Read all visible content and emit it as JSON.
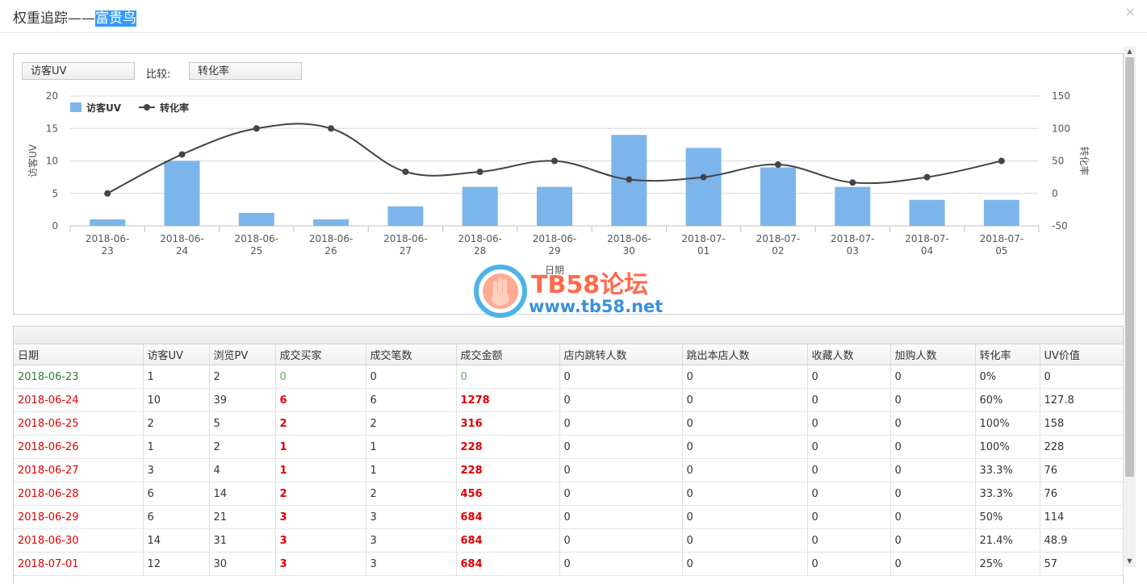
{
  "dialog": {
    "title_prefix": "权重追踪——",
    "title_highlight": "富贵鸟",
    "close": "×"
  },
  "controls": {
    "primary_select": "访客UV",
    "compare_label": "比较:",
    "compare_select": "转化率"
  },
  "chart_data": {
    "type": "bar+line",
    "categories": [
      "2018-06-23",
      "2018-06-24",
      "2018-06-25",
      "2018-06-26",
      "2018-06-27",
      "2018-06-28",
      "2018-06-29",
      "2018-06-30",
      "2018-07-01",
      "2018-07-02",
      "2018-07-03",
      "2018-07-04",
      "2018-07-05"
    ],
    "series": [
      {
        "name": "访客UV",
        "type": "bar",
        "axis": "left",
        "color": "#7cb5ec",
        "values": [
          1,
          10,
          2,
          1,
          3,
          6,
          6,
          14,
          12,
          9,
          6,
          4,
          4
        ]
      },
      {
        "name": "转化率",
        "type": "line",
        "axis": "right",
        "color": "#434348",
        "values": [
          0,
          60,
          100,
          100,
          33.3,
          33.3,
          50,
          21.4,
          25,
          44.4,
          16.7,
          25,
          50
        ]
      }
    ],
    "xlabel": "日期",
    "ylabel_left": "访客UV",
    "ylabel_right": "转化率",
    "ylim_left": [
      0,
      20
    ],
    "yticks_left": [
      0,
      5,
      10,
      15,
      20
    ],
    "ylim_right": [
      -50,
      150
    ],
    "yticks_right": [
      -50,
      0,
      50,
      100,
      150
    ],
    "grid": true,
    "legend": "top-left"
  },
  "table": {
    "columns": [
      "日期",
      "访客UV",
      "浏览PV",
      "成交买家",
      "成交笔数",
      "成交金额",
      "店内跳转人数",
      "跳出本店人数",
      "收藏人数",
      "加购人数",
      "转化率",
      "UV价值"
    ],
    "rows": [
      [
        "2018-06-23",
        "1",
        "2",
        "0",
        "0",
        "0",
        "0",
        "0",
        "0",
        "0",
        "0%",
        "0"
      ],
      [
        "2018-06-24",
        "10",
        "39",
        "6",
        "6",
        "1278",
        "0",
        "0",
        "0",
        "0",
        "60%",
        "127.8"
      ],
      [
        "2018-06-25",
        "2",
        "5",
        "2",
        "2",
        "316",
        "0",
        "0",
        "0",
        "0",
        "100%",
        "158"
      ],
      [
        "2018-06-26",
        "1",
        "2",
        "1",
        "1",
        "228",
        "0",
        "0",
        "0",
        "0",
        "100%",
        "228"
      ],
      [
        "2018-06-27",
        "3",
        "4",
        "1",
        "1",
        "228",
        "0",
        "0",
        "0",
        "0",
        "33.3%",
        "76"
      ],
      [
        "2018-06-28",
        "6",
        "14",
        "2",
        "2",
        "456",
        "0",
        "0",
        "0",
        "0",
        "33.3%",
        "76"
      ],
      [
        "2018-06-29",
        "6",
        "21",
        "3",
        "3",
        "684",
        "0",
        "0",
        "0",
        "0",
        "50%",
        "114"
      ],
      [
        "2018-06-30",
        "14",
        "31",
        "3",
        "3",
        "684",
        "0",
        "0",
        "0",
        "0",
        "21.4%",
        "48.9"
      ],
      [
        "2018-07-01",
        "12",
        "30",
        "3",
        "3",
        "684",
        "0",
        "0",
        "0",
        "0",
        "25%",
        "57"
      ]
    ]
  },
  "watermark": {
    "line1": "TB58论坛",
    "line2": "www.tb58.net"
  },
  "colors": {
    "bar": "#7cb5ec",
    "line": "#434348",
    "date_first": "#2e7d32",
    "date_other": "#e00000",
    "highlight_bg": "#3399ff"
  }
}
